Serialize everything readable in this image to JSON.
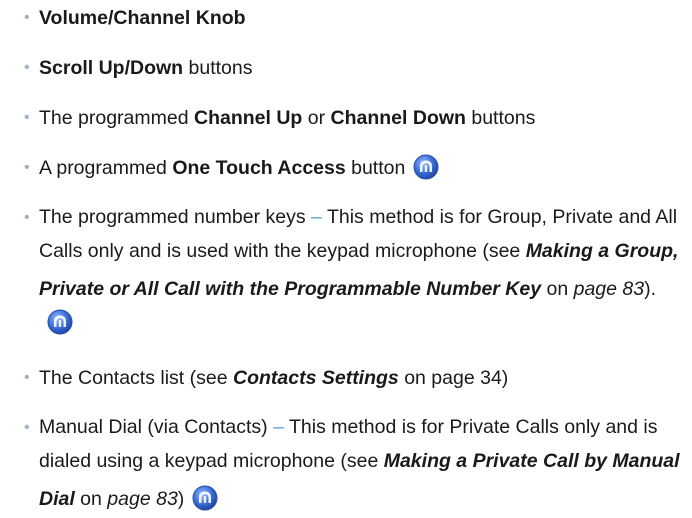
{
  "items": [
    {
      "bold": "Volume/Channel Knob"
    },
    {
      "bold": "Scroll Up/Down",
      "after": " buttons"
    },
    {
      "before": "The programmed ",
      "bold1": "Channel Up",
      "mid": " or ",
      "bold2": "Channel Down",
      "after": " buttons"
    },
    {
      "before": "A programmed ",
      "bold": "One Touch Access",
      "after": " button"
    },
    {
      "before": "The programmed number keys ",
      "dash": "–",
      "mid": " This method is for Group, Private and All Calls only and is used with the keypad microphone (see ",
      "link": "Making a Group, Private or All Call with the Programmable Number Key",
      "on": " on ",
      "page": "page 83",
      "after": ")."
    },
    {
      "before": "The Contacts list (see ",
      "link": "Contacts Settings",
      "after": " on page 34)"
    },
    {
      "before": "Manual Dial (via Contacts) ",
      "dash": "–",
      "mid": " This method is for Private Calls only and is dialed using a keypad microphone (see ",
      "link": "Making a Private Call by Manual Dial",
      "on": " on ",
      "page": "page 83",
      "after": ")"
    }
  ],
  "bullet_glyph": "•",
  "icon_name": "feature-radio-icon",
  "colors": {
    "bullet": "#9fb3c4",
    "dash": "#5aa0d0",
    "icon": "#3a6fd8"
  }
}
